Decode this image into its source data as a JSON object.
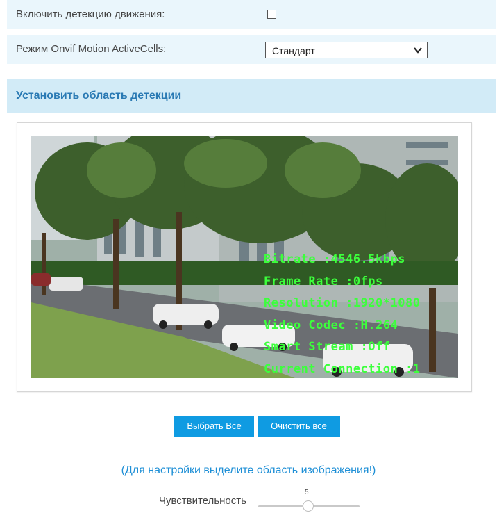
{
  "settings": {
    "motion_detection_label": "Включить детекцию движения:",
    "motion_detection_checked": false,
    "onvif_mode_label": "Режим Onvif Motion ActiveCells:",
    "onvif_mode_value": "Стандарт"
  },
  "detection_area": {
    "title": "Установить область детекции",
    "overlay": {
      "bitrate": "Bitrate :4546.5kbps",
      "frame_rate": "Frame Rate :0fps",
      "resolution": "Resolution :1920*1080",
      "video_codec": "Video Codec :H.264",
      "smart_stream": "Smart Stream :Off",
      "current_connection": "Current Connection :1"
    },
    "select_all_label": "Выбрать Все",
    "clear_all_label": "Очистить все",
    "hint": "(Для настройки выделите область изображения!)"
  },
  "sensitivity": {
    "label": "Чувствительность",
    "value": "5",
    "level_fraction": 0.45
  },
  "colors": {
    "accent": "#0f9be2",
    "row_bg": "#eaf6fc",
    "section_bg": "#d2ebf7",
    "overlay_text": "#3cff3c"
  }
}
